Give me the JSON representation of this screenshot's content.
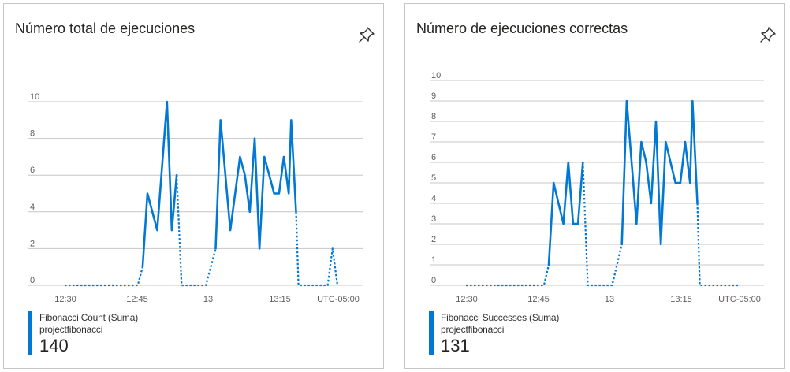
{
  "colors": {
    "series": "#0078d4",
    "grid": "#c8c6c4",
    "axis_text": "#605e5c",
    "tile_border": "#c8c6c4"
  },
  "tiles": [
    {
      "title": "Número total de ejecuciones",
      "pin_icon": "pin-icon",
      "legend": {
        "series_label": "Fibonacci Count (Suma)",
        "resource": "projectfibonacci",
        "total": "140"
      }
    },
    {
      "title": "Número de ejecuciones correctas",
      "pin_icon": "pin-icon",
      "legend": {
        "series_label": "Fibonacci Successes (Suma)",
        "resource": "projectfibonacci",
        "total": "131"
      }
    }
  ],
  "chart_data": [
    {
      "type": "line",
      "title": "Número total de ejecuciones",
      "xlabel": "",
      "ylabel": "",
      "ylim": [
        0,
        10
      ],
      "y_ticks": [
        0,
        2,
        4,
        6,
        8,
        10
      ],
      "x_ticks": [
        "12:30",
        "12:45",
        "13",
        "13:15",
        "UTC-05:00"
      ],
      "x_range_minutes": [
        -36,
        20
      ],
      "grid": true,
      "series": [
        {
          "name": "Fibonacci Count (Suma)",
          "solid_segments": [
            [
              [
                -20,
                1
              ],
              [
                -19,
                5
              ],
              [
                -17,
                3
              ],
              [
                -15,
                10
              ],
              [
                -14,
                3
              ],
              [
                -13,
                6
              ]
            ],
            [
              [
                -5,
                2
              ],
              [
                -4,
                9
              ],
              [
                -2,
                3
              ],
              [
                0,
                7
              ],
              [
                1,
                6
              ],
              [
                2,
                4
              ],
              [
                3,
                8
              ],
              [
                4,
                2
              ],
              [
                5,
                7
              ],
              [
                7,
                5
              ],
              [
                8,
                5
              ],
              [
                9,
                7
              ],
              [
                10,
                5
              ],
              [
                10.5,
                9
              ],
              [
                11.5,
                4
              ]
            ]
          ],
          "dotted_segments": [
            [
              [
                -36,
                0
              ],
              [
                -21,
                0
              ],
              [
                -20,
                1
              ]
            ],
            [
              [
                -13,
                6
              ],
              [
                -12,
                0
              ],
              [
                -7,
                0
              ],
              [
                -5,
                2
              ]
            ],
            [
              [
                11.5,
                4
              ],
              [
                12,
                0
              ],
              [
                18,
                0
              ],
              [
                19,
                2
              ],
              [
                20,
                0
              ]
            ]
          ]
        }
      ]
    },
    {
      "type": "line",
      "title": "Número de ejecuciones correctas",
      "xlabel": "",
      "ylabel": "",
      "ylim": [
        0,
        10
      ],
      "y_ticks": [
        0,
        1,
        2,
        3,
        4,
        5,
        6,
        7,
        8,
        9,
        10
      ],
      "x_ticks": [
        "12:30",
        "12:45",
        "13",
        "13:15",
        "UTC-05:00"
      ],
      "x_range_minutes": [
        -36,
        20
      ],
      "grid": true,
      "series": [
        {
          "name": "Fibonacci Successes (Suma)",
          "solid_segments": [
            [
              [
                -19,
                1
              ],
              [
                -18,
                5
              ],
              [
                -16,
                3
              ],
              [
                -15,
                6
              ],
              [
                -14,
                3
              ],
              [
                -13,
                3
              ],
              [
                -12,
                6
              ]
            ],
            [
              [
                -4,
                2
              ],
              [
                -3,
                9
              ],
              [
                -1,
                3
              ],
              [
                0,
                7
              ],
              [
                1,
                6
              ],
              [
                2,
                4
              ],
              [
                3,
                8
              ],
              [
                4,
                2
              ],
              [
                5,
                7
              ],
              [
                7,
                5
              ],
              [
                8,
                5
              ],
              [
                9,
                7
              ],
              [
                10,
                5
              ],
              [
                10.5,
                9
              ],
              [
                11.5,
                4
              ]
            ]
          ],
          "dotted_segments": [
            [
              [
                -36,
                0
              ],
              [
                -20,
                0
              ],
              [
                -19,
                1
              ]
            ],
            [
              [
                -12,
                6
              ],
              [
                -11,
                0
              ],
              [
                -6,
                0
              ],
              [
                -4,
                2
              ]
            ],
            [
              [
                11.5,
                4
              ],
              [
                12,
                0
              ],
              [
                20,
                0
              ]
            ]
          ]
        }
      ]
    }
  ]
}
